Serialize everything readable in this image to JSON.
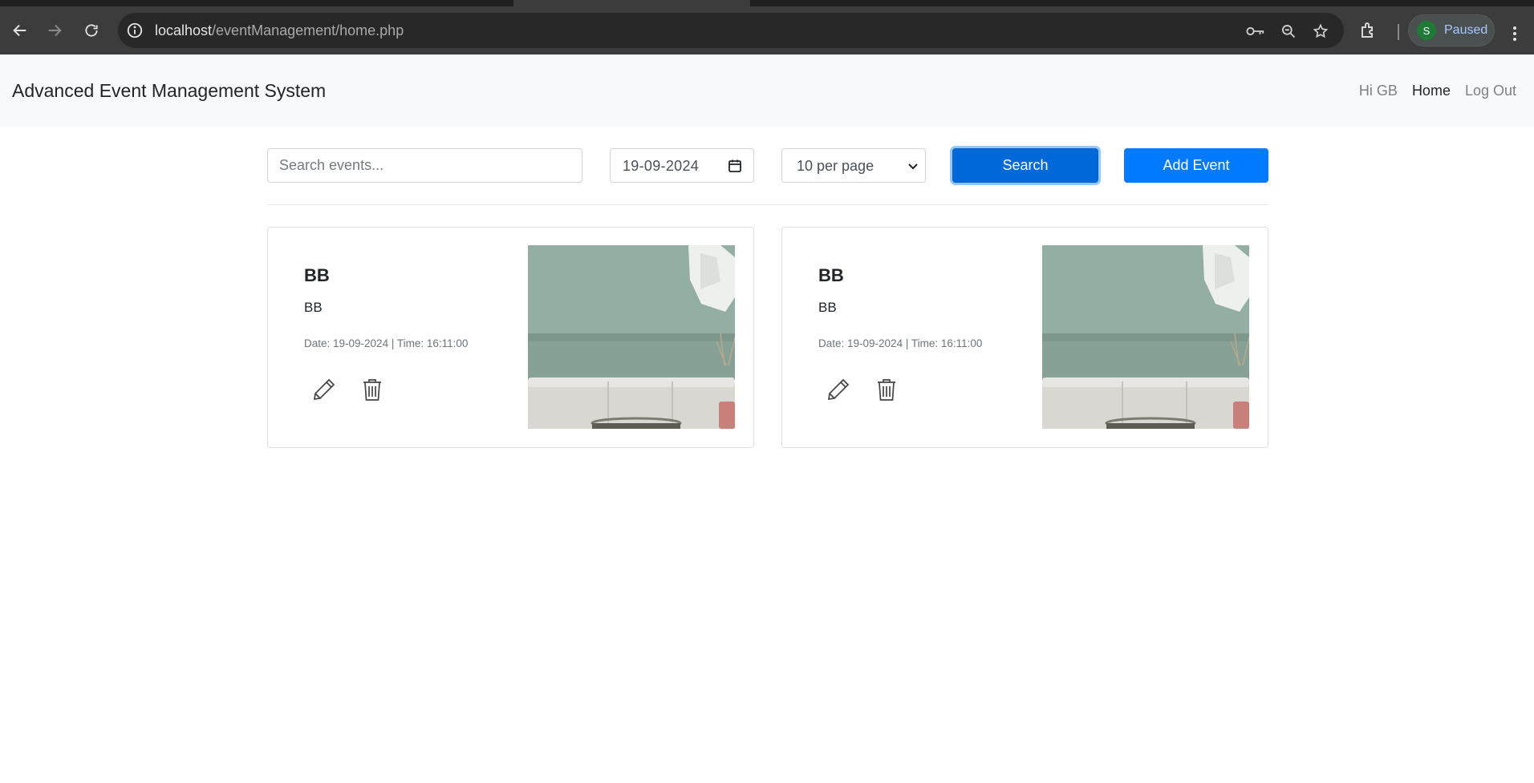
{
  "browser": {
    "url_host": "localhost",
    "url_path": "/eventManagement/home.php",
    "profile_initial": "S",
    "profile_status": "Paused"
  },
  "navbar": {
    "brand": "Advanced Event Management System",
    "links": [
      "Hi GB",
      "Home",
      "Log Out"
    ]
  },
  "filters": {
    "search_placeholder": "Search events...",
    "date_value": "19-09-2024",
    "per_page": "10 per page",
    "search_label": "Search",
    "add_label": "Add Event"
  },
  "events": [
    {
      "title": "BB",
      "description": "BB",
      "meta": "Date: 19-09-2024 | Time: 16:11:00"
    },
    {
      "title": "BB",
      "description": "BB",
      "meta": "Date: 19-09-2024 | Time: 16:11:00"
    }
  ],
  "colors": {
    "primary": "#007bff",
    "primary_active": "#0069d9",
    "navbar_bg": "#f8f9fa",
    "chrome_bg": "#3c3c3c"
  },
  "icons": [
    "back-arrow-icon",
    "forward-arrow-icon",
    "reload-icon",
    "info-icon",
    "key-icon",
    "zoom-icon",
    "star-icon",
    "extensions-icon",
    "kebab-menu-icon",
    "calendar-icon",
    "chevron-down-icon",
    "pencil-icon",
    "trash-icon"
  ]
}
